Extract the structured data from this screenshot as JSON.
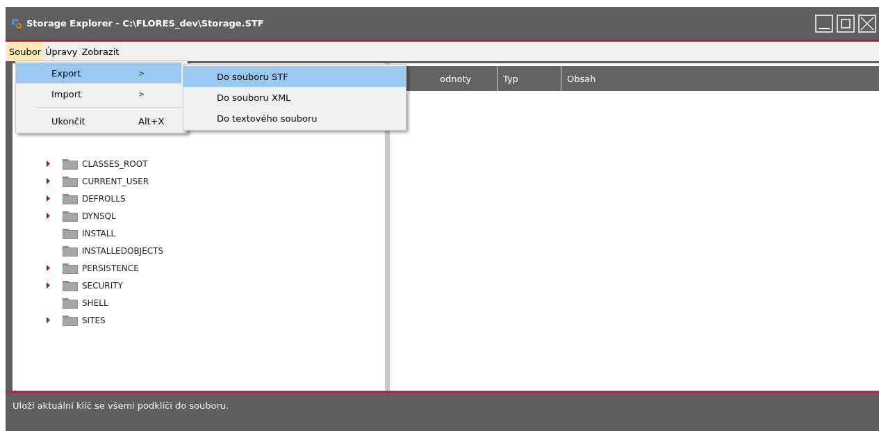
{
  "window": {
    "title": "Storage Explorer - C:\\FLORES_dev\\Storage.STF"
  },
  "menu_bar": [
    {
      "label": "Soubor",
      "selected": true
    },
    {
      "label": "Úpravy",
      "selected": false
    },
    {
      "label": "Zobrazit",
      "selected": false
    }
  ],
  "open_menu": {
    "items": [
      {
        "kind": "item",
        "label": "Export",
        "arrow": ">",
        "selected": true
      },
      {
        "kind": "item",
        "label": "Import",
        "arrow": ">",
        "selected": false
      },
      {
        "kind": "separator"
      },
      {
        "kind": "item",
        "label": "Ukončit",
        "shortcut": "Alt+X",
        "selected": false
      }
    ]
  },
  "submenu": {
    "items": [
      {
        "label": "Do souboru STF",
        "selected": true
      },
      {
        "label": "Do souboru XML",
        "selected": false
      },
      {
        "label": "Do textového souboru",
        "selected": false
      }
    ]
  },
  "tree": {
    "items": [
      {
        "label": "CLASSES_ROOT",
        "has_children": true
      },
      {
        "label": "CURRENT_USER",
        "has_children": true
      },
      {
        "label": "DEFROLLS",
        "has_children": true
      },
      {
        "label": "DYNSQL",
        "has_children": true
      },
      {
        "label": "INSTALL",
        "has_children": false
      },
      {
        "label": "INSTALLEDOBJECTS",
        "has_children": false
      },
      {
        "label": "PERSISTENCE",
        "has_children": true
      },
      {
        "label": "SECURITY",
        "has_children": true
      },
      {
        "label": "SHELL",
        "has_children": false
      },
      {
        "label": "SITES",
        "has_children": true
      }
    ]
  },
  "list": {
    "columns": [
      "odnoty",
      "Typ",
      "Obsah"
    ]
  },
  "status_bar": {
    "text": "Uloží aktuální klíč se všemi podklíči do souboru."
  }
}
